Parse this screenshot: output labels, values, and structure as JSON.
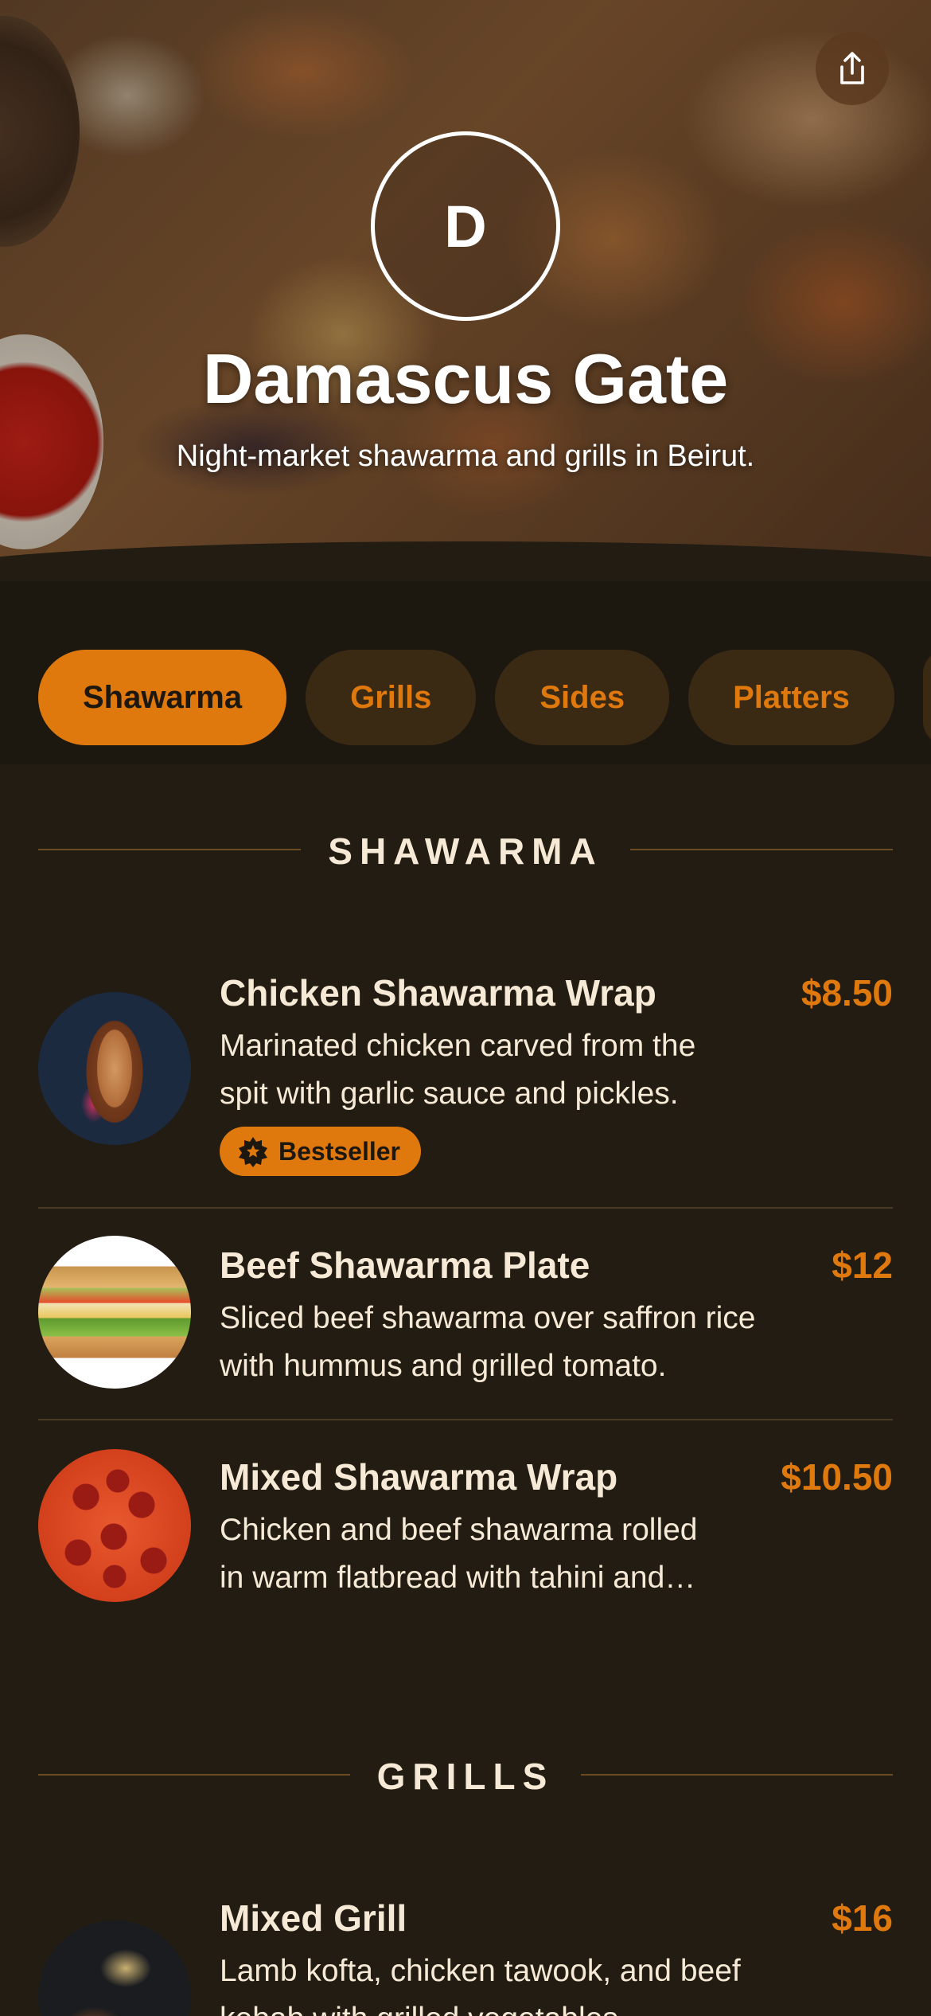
{
  "restaurant": {
    "initial": "D",
    "name": "Damascus Gate",
    "tagline": "Night-market shawarma and grills in Beirut."
  },
  "header": {
    "share_icon": "share-icon"
  },
  "tabs": [
    {
      "label": "Shawarma",
      "active": true
    },
    {
      "label": "Grills",
      "active": false
    },
    {
      "label": "Sides",
      "active": false
    },
    {
      "label": "Platters",
      "active": false
    }
  ],
  "sections": [
    {
      "title": "SHAWARMA",
      "items": [
        {
          "name": "Chicken Shawarma Wrap",
          "price": "$8.50",
          "description_line1": "Marinated chicken carved from the",
          "description_line2": "spit with garlic sauce and pickles.",
          "badge": "Bestseller",
          "badge_icon": "star-badge-icon"
        },
        {
          "name": "Beef Shawarma Plate",
          "price": "$12",
          "description_line1": "Sliced beef shawarma over saffron rice",
          "description_line2": "with hummus and grilled tomato."
        },
        {
          "name": "Mixed Shawarma Wrap",
          "price": "$10.50",
          "description_line1": "Chicken and beef shawarma rolled",
          "description_line2": "in warm flatbread with tahini and…"
        }
      ]
    },
    {
      "title": "GRILLS",
      "items": [
        {
          "name": "Mixed Grill",
          "price": "$16",
          "description_line1": "Lamb kofta, chicken tawook, and beef",
          "description_line2": "kebab with grilled vegetables."
        }
      ]
    }
  ],
  "colors": {
    "background": "#221c12",
    "accent": "#e0790d",
    "tab_inactive_bg": "#3a2a14",
    "text": "#f6ead6"
  }
}
